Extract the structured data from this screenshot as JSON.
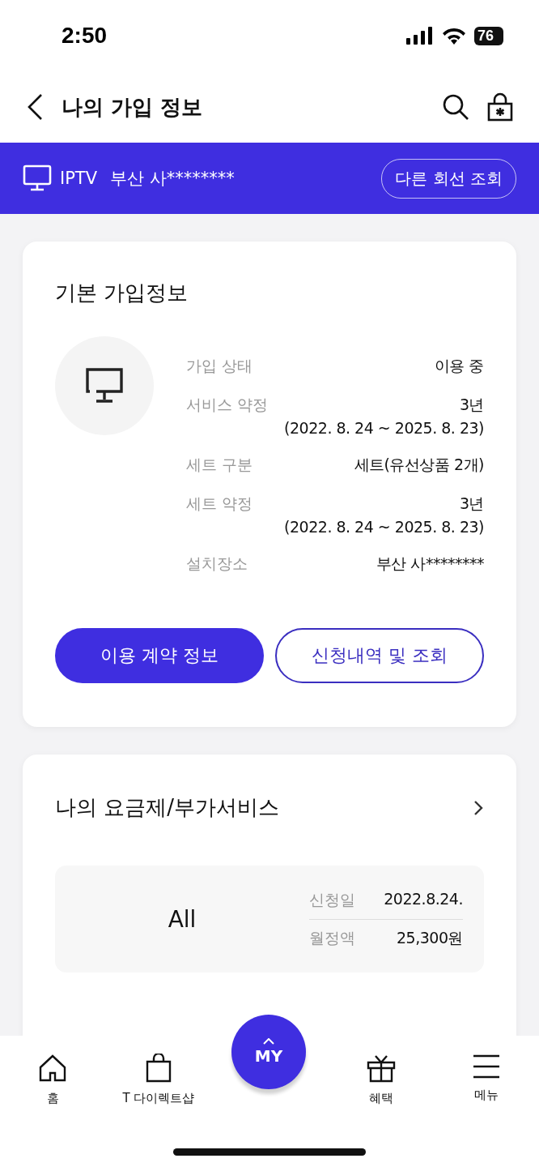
{
  "status_bar": {
    "time": "2:50",
    "battery": "76"
  },
  "header": {
    "title": "나의 가입 정보"
  },
  "line_banner": {
    "service": "IPTV",
    "location": "부산 사********",
    "button": "다른 회선 조회"
  },
  "basic_info": {
    "title": "기본 가입정보",
    "rows": [
      {
        "label": "가입 상태",
        "value": "이용 중"
      },
      {
        "label": "서비스 약정",
        "value": "3년",
        "sub": "(2022. 8. 24 ~ 2025. 8. 23)"
      },
      {
        "label": "세트 구분",
        "value": "세트(유선상품 2개)"
      },
      {
        "label": "세트 약정",
        "value": "3년",
        "sub": "(2022. 8. 24 ~ 2025. 8. 23)"
      },
      {
        "label": "설치장소",
        "value": "부산 사********"
      }
    ],
    "buttons": [
      {
        "label": "이용 계약 정보",
        "kind": "primary"
      },
      {
        "label": "신청내역 및 조회",
        "kind": "outline"
      }
    ]
  },
  "plans": {
    "title": "나의 요금제/부가서비스",
    "plan_name": "All",
    "details": [
      {
        "label": "신청일",
        "value": "2022.8.24."
      },
      {
        "label": "월정액",
        "value": "25,300원"
      }
    ]
  },
  "bottom_nav": {
    "items": [
      {
        "label": "홈",
        "kind": "home"
      },
      {
        "label": "T 다이렉트샵",
        "kind": "shop"
      },
      {
        "label": "혜택",
        "kind": "benefits"
      },
      {
        "label": "메뉴",
        "kind": "menu"
      }
    ],
    "center": {
      "label": "MY"
    }
  }
}
